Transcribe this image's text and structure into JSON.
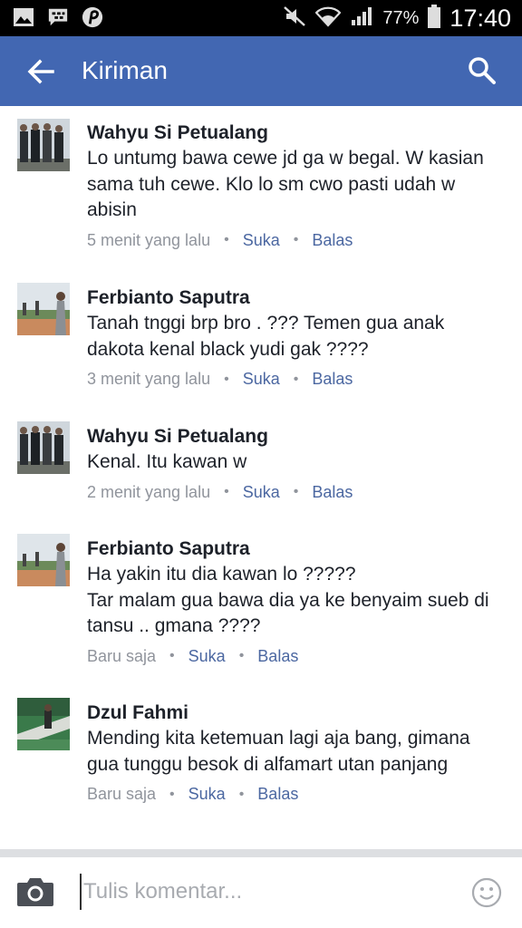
{
  "status_bar": {
    "icons_left": [
      "gallery-icon",
      "bbm-icon",
      "pinterest-icon"
    ],
    "icons_right": [
      "mute-icon",
      "wifi-icon",
      "signal-icon",
      "battery-icon"
    ],
    "battery": "77%",
    "time": "17:40"
  },
  "app_bar": {
    "title": "Kiriman",
    "back_icon": "arrow-back-icon",
    "search_icon": "search-icon",
    "color": "#4267b2"
  },
  "comments": [
    {
      "author": "Wahyu Si Petualang",
      "text": "Lo untumg bawa cewe jd ga w begal. W kasian sama tuh cewe. Klo lo sm cwo pasti udah w abisin",
      "time": "5 menit yang lalu",
      "like": "Suka",
      "reply": "Balas"
    },
    {
      "author": "Ferbianto Saputra",
      "text": "Tanah tnggi brp bro . ??? Temen gua anak dakota kenal black yudi gak ????",
      "time": "3 menit yang lalu",
      "like": "Suka",
      "reply": "Balas"
    },
    {
      "author": "Wahyu Si Petualang",
      "text": "Kenal. Itu kawan w",
      "time": "2 menit yang lalu",
      "like": "Suka",
      "reply": "Balas"
    },
    {
      "author": "Ferbianto Saputra",
      "text": "Ha yakin itu dia kawan lo ?????\nTar malam gua bawa dia ya ke benyaim sueb di tansu .. gmana ????",
      "time": "Baru saja",
      "like": "Suka",
      "reply": "Balas"
    },
    {
      "author": "Dzul Fahmi",
      "text": "Mending kita ketemuan lagi aja bang, gimana gua tunggu besok di alfamart utan panjang",
      "time": "Baru saja",
      "like": "Suka",
      "reply": "Balas"
    }
  ],
  "composer": {
    "placeholder": "Tulis komentar...",
    "camera_icon": "camera-icon",
    "emoji_icon": "smiley-icon"
  }
}
